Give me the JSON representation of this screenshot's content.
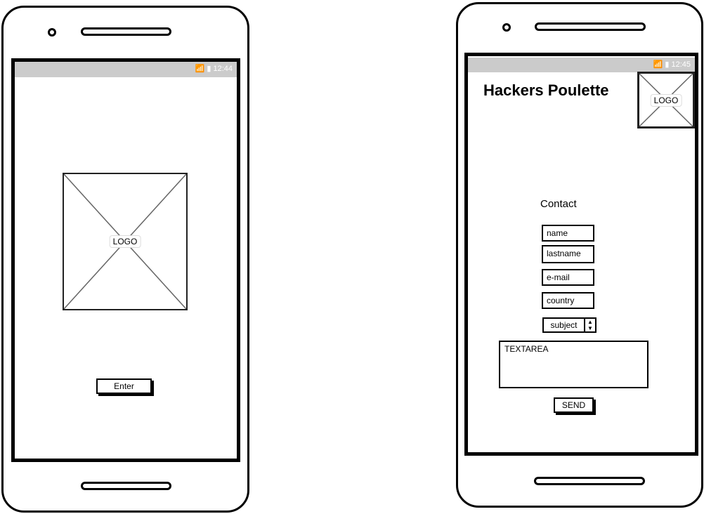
{
  "screen_welcome": {
    "status_time": "12:44",
    "logo_label": "LOGO",
    "enter_label": "Enter"
  },
  "screen_contact": {
    "status_time": "12:45",
    "title": "Hackers Poulette",
    "logo_label": "LOGO",
    "contact_label": "Contact",
    "fields": {
      "name": "name",
      "lastname": "lastname",
      "email": "e-mail",
      "country": "country"
    },
    "subject_select": "subject",
    "textarea": "TEXTAREA",
    "send_label": "SEND"
  }
}
